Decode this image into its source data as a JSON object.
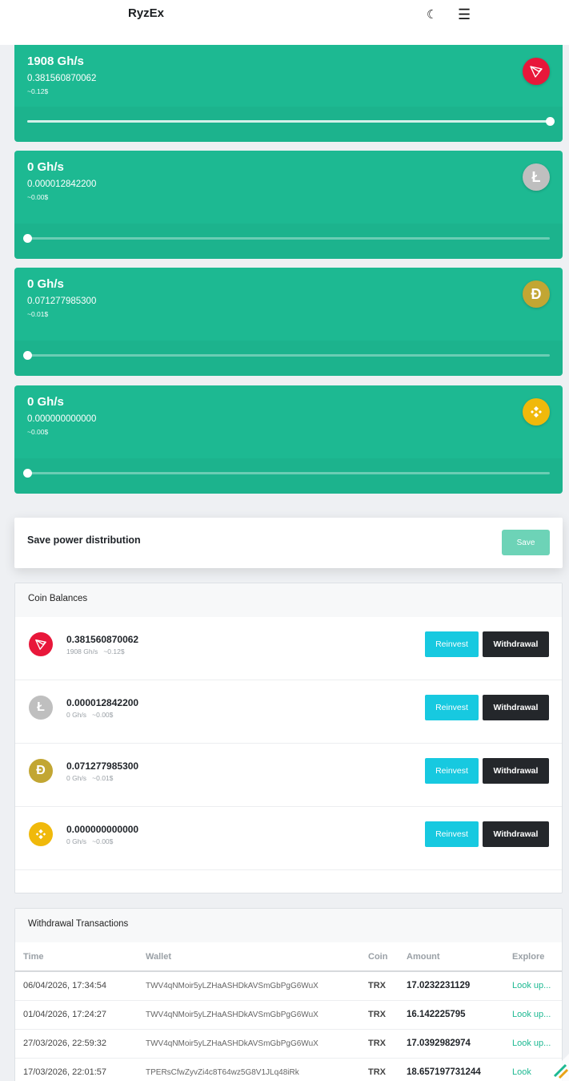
{
  "header": {
    "brand": "RyzEx",
    "theme_icon": "moon-icon",
    "menu_icon": "menu-icon"
  },
  "power_cards": [
    {
      "speed": "1908 Gh/s",
      "amount": "0.381560870062",
      "usd": "~0.12$",
      "coin": "TRX",
      "level": 1.0
    },
    {
      "speed": "0 Gh/s",
      "amount": "0.000012842200",
      "usd": "~0.00$",
      "coin": "LTC",
      "level": 0
    },
    {
      "speed": "0 Gh/s",
      "amount": "0.071277985300",
      "usd": "~0.01$",
      "coin": "DOGE",
      "level": 0
    },
    {
      "speed": "0 Gh/s",
      "amount": "0.000000000000",
      "usd": "~0.00$",
      "coin": "BNB",
      "level": 0
    }
  ],
  "save_panel": {
    "label": "Save power distribution",
    "button": "Save"
  },
  "balances": {
    "title": "Coin Balances",
    "rows": [
      {
        "balance": "0.381560870062",
        "speed": "1908 Gh/s",
        "usd": "~0.12$"
      },
      {
        "balance": "0.000012842200",
        "speed": "0 Gh/s",
        "usd": "~0.00$"
      },
      {
        "balance": "0.071277985300",
        "speed": "0 Gh/s",
        "usd": "~0.01$"
      },
      {
        "balance": "0.000000000000",
        "speed": "0 Gh/s",
        "usd": "~0.00$"
      }
    ],
    "reinvest_label": "Reinvest",
    "withdrawal_label": "Withdrawal"
  },
  "transactions": {
    "title": "Withdrawal Transactions",
    "columns": [
      "Time",
      "Wallet",
      "Coin",
      "Amount",
      "Explore"
    ],
    "rows": [
      {
        "time": "06/04/2026, 17:34:54",
        "wallet": "TWV4qNMoir5yLZHaASHDkAVSmGbPgG6WuX",
        "coin": "TRX",
        "amount": "17.0232231129",
        "explore": "Look up..."
      },
      {
        "time": "01/04/2026, 17:24:27",
        "wallet": "TWV4qNMoir5yLZHaASHDkAVSmGbPgG6WuX",
        "coin": "TRX",
        "amount": "16.142225795",
        "explore": "Look up..."
      },
      {
        "time": "27/03/2026, 22:59:32",
        "wallet": "TWV4qNMoir5yLZHaASHDkAVSmGbPgG6WuX",
        "coin": "TRX",
        "amount": "17.0392982974",
        "explore": "Look up..."
      },
      {
        "time": "17/03/2026, 22:01:57",
        "wallet": "TPERsCfwZyvZi4c8T64wz5G8V1JLq48iRk",
        "coin": "TRX",
        "amount": "18.657197731244",
        "explore": "Look"
      }
    ]
  },
  "colors": {
    "accent": "#1db992",
    "reinvest": "#17c9e0",
    "withdrawal": "#24272b",
    "trx": "#e8173a",
    "ltc": "#bfbfbf",
    "doge": "#c2a633",
    "bnb": "#f0b90b"
  }
}
